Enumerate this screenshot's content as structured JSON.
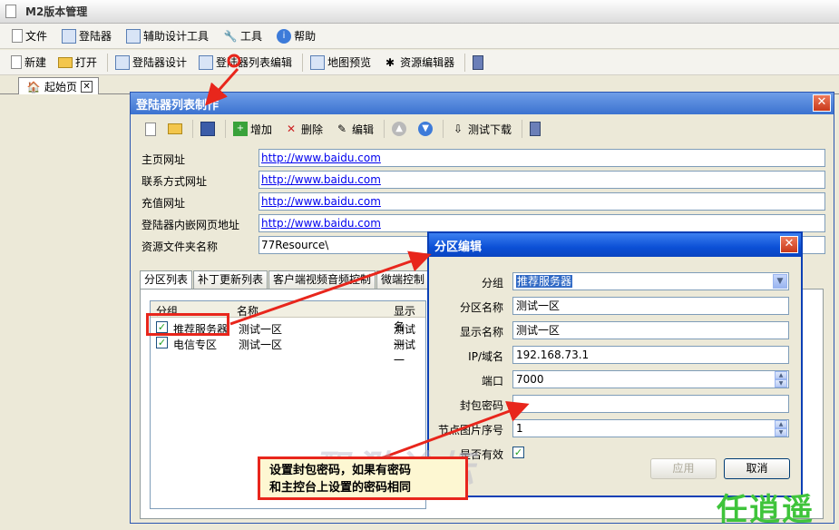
{
  "app": {
    "title": "M2版本管理",
    "menu": [
      "文件",
      "登陆器",
      "辅助设计工具",
      "工具",
      "帮助"
    ],
    "toolbar": [
      "新建",
      "打开",
      "登陆器设计",
      "登陆器列表编辑",
      "地图预览",
      "资源编辑器"
    ],
    "tab": "起始页"
  },
  "launcher_dialog": {
    "title": "登陆器列表制作",
    "toolbar": {
      "add": "增加",
      "delete": "删除",
      "edit": "编辑",
      "test_download": "测试下载"
    },
    "fields": [
      {
        "label": "主页网址",
        "value": "http://www.baidu.com"
      },
      {
        "label": "联系方式网址",
        "value": "http://www.baidu.com"
      },
      {
        "label": "充值网址",
        "value": "http://www.baidu.com"
      },
      {
        "label": "登陆器内嵌网页地址",
        "value": "http://www.baidu.com"
      },
      {
        "label": "资源文件夹名称",
        "value": "77Resource\\"
      }
    ],
    "tabs": [
      "分区列表",
      "补丁更新列表",
      "客户端视频音频控制",
      "微端控制"
    ],
    "list": {
      "columns": [
        "分组",
        "名称",
        "显示名"
      ],
      "rows": [
        {
          "group": "推荐服务器",
          "name": "测试一区",
          "display": "测试一"
        },
        {
          "group": "电信专区",
          "name": "测试一区",
          "display": "测试一"
        }
      ]
    }
  },
  "zone_dialog": {
    "title": "分区编辑",
    "fields": {
      "group": {
        "label": "分组",
        "value": "推荐服务器"
      },
      "zone_name": {
        "label": "分区名称",
        "value": "测试一区"
      },
      "display_name": {
        "label": "显示名称",
        "value": "测试一区"
      },
      "ip": {
        "label": "IP/域名",
        "value": "192.168.73.1"
      },
      "port": {
        "label": "端口",
        "value": "7000"
      },
      "packet_password": {
        "label": "封包密码",
        "value": ""
      },
      "node_image": {
        "label": "节点图片序号",
        "value": "1"
      },
      "valid": {
        "label": "是否有效"
      }
    },
    "apply": "应用",
    "cancel": "取消"
  },
  "annotation": {
    "line1": "设置封包密码，如果有密码",
    "line2": "和主控台上设置的密码相同"
  },
  "watermark": {
    "brand": "任逍遥",
    "site": "飘渺论坛"
  },
  "colors": {
    "accent": "#e8261c",
    "title_blue": "#0b4fd6"
  }
}
